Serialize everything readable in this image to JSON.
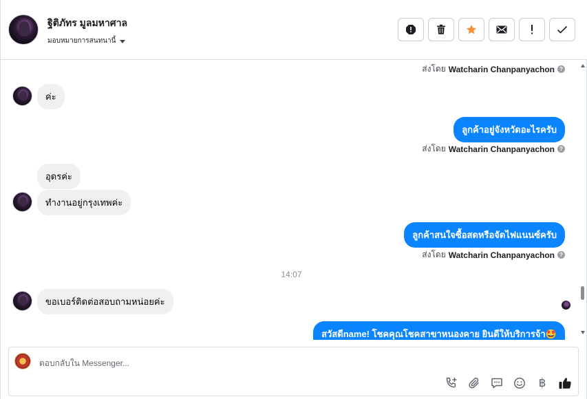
{
  "header": {
    "name": "ฐิติภัทร มูลมหาศาล",
    "assign_label": "มอบหมายการสนทนานี้"
  },
  "actions": [
    {
      "icon": "report-icon"
    },
    {
      "icon": "trash-icon"
    },
    {
      "icon": "star-icon",
      "color": "#f7923b"
    },
    {
      "icon": "envelope-icon"
    },
    {
      "icon": "exclamation-icon",
      "label": "!"
    },
    {
      "icon": "check-icon"
    }
  ],
  "thread": {
    "sent_by_prefix": "ส่งโดย",
    "agent_name": "Watcharin Chanpanyachon",
    "messages": {
      "in_1": "ค่ะ",
      "out_1": "ลูกค้าอยู่จังหวัดอะไรครับ",
      "in_2": "อุดรค่ะ",
      "in_3": "ทำงานอยู่กรุงเทพค่ะ",
      "out_2": "ลูกค้าสนใจซื้อสดหรือจัดไฟแนนซ์ครับ",
      "time": "14:07",
      "in_4": "ขอเบอร์ติดต่อสอบถามหน่อยค่ะ",
      "out_3": "สวัสดีname! โชคคุณโชคสาขาหนองคาย ยินดีให้บริการจ้า🤩"
    }
  },
  "composer": {
    "placeholder": "ตอบกลับใน Messenger..."
  },
  "colors": {
    "bubble_out": "#0a84ff",
    "bubble_in": "#f0f0f0"
  }
}
